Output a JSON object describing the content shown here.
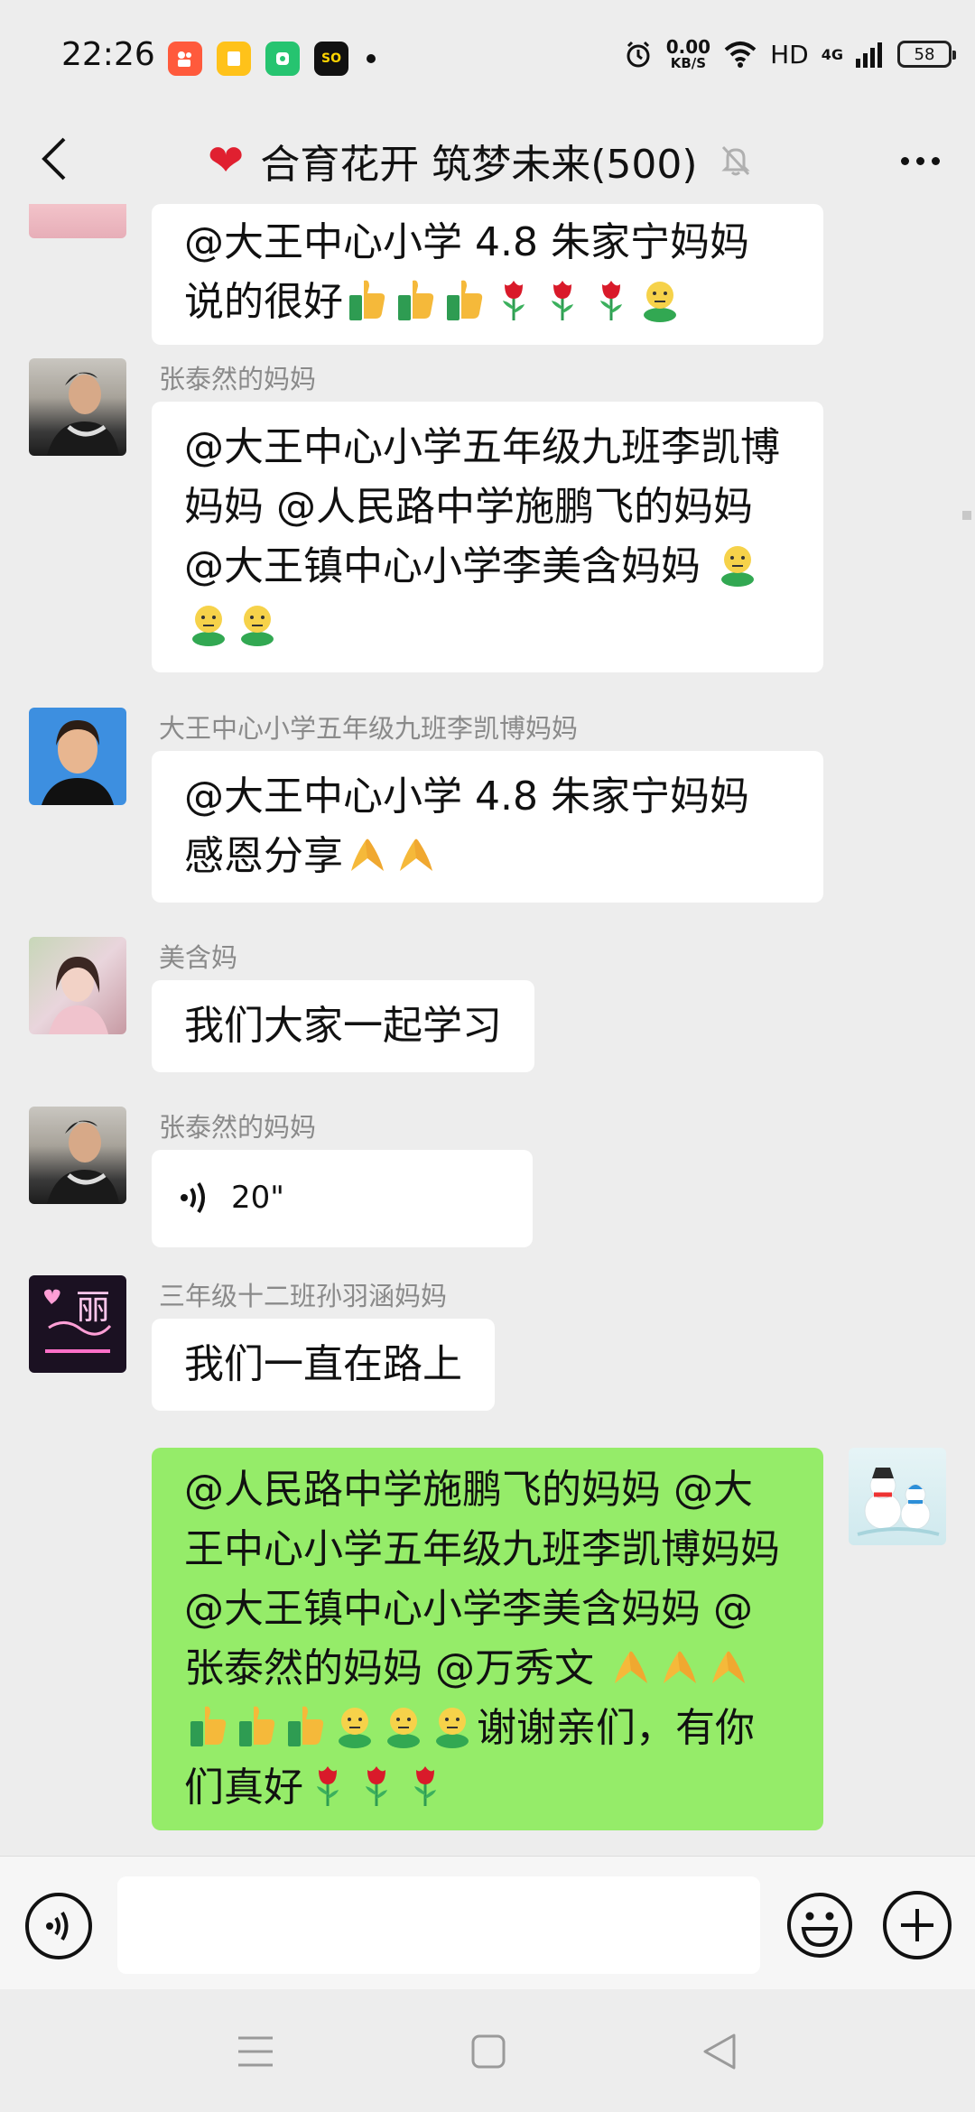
{
  "status_bar": {
    "time": "22:26",
    "net_speed_value": "0.00",
    "net_speed_unit": "KB/S",
    "hd": "HD",
    "network": "4G",
    "battery": "58",
    "app_icons": [
      {
        "name": "kuaishou-icon",
        "color": "#ff5a3c",
        "label": ""
      },
      {
        "name": "notes-app-icon",
        "color": "#ffc21a",
        "label": ""
      },
      {
        "name": "green-app-icon",
        "color": "#26c470",
        "label": ""
      },
      {
        "name": "soul-app-icon",
        "color": "#111111",
        "label": "SO"
      }
    ]
  },
  "header": {
    "title": "合育花开 筑梦未来(500)",
    "heart_emoji": "❤"
  },
  "messages": [
    {
      "sender": "",
      "text": "@大王中心小学 4.8 朱家宁妈妈 说的很好"
    },
    {
      "sender": "张泰然的妈妈",
      "text": "@大王中心小学五年级九班李凯博妈妈 @人民路中学施鹏飞的妈妈 @大王镇中心小学李美含妈妈 "
    },
    {
      "sender": "大王中心小学五年级九班李凯博妈妈",
      "text": "@大王中心小学 4.8 朱家宁妈妈 感恩分享"
    },
    {
      "sender": "美含妈",
      "text": "我们大家一起学习"
    },
    {
      "sender": "张泰然的妈妈",
      "voice_duration": "20\""
    },
    {
      "sender": "三年级十二班孙羽涵妈妈",
      "text": "我们一直在路上",
      "avatar_text": "丽"
    },
    {
      "sender": "",
      "text_a": "@人民路中学施鹏飞的妈妈 @大王中心小学五年级九班李凯博妈妈 @大王镇中心小学李美含妈妈 @张泰然的妈妈 @万秀文 ",
      "text_b": "谢谢亲们，有你们真好"
    }
  ],
  "input_bar": {
    "placeholder": ""
  },
  "colors": {
    "background": "#ededed",
    "my_bubble": "#95ec69",
    "their_bubble": "#ffffff",
    "sender_name": "#8a8a8a"
  }
}
